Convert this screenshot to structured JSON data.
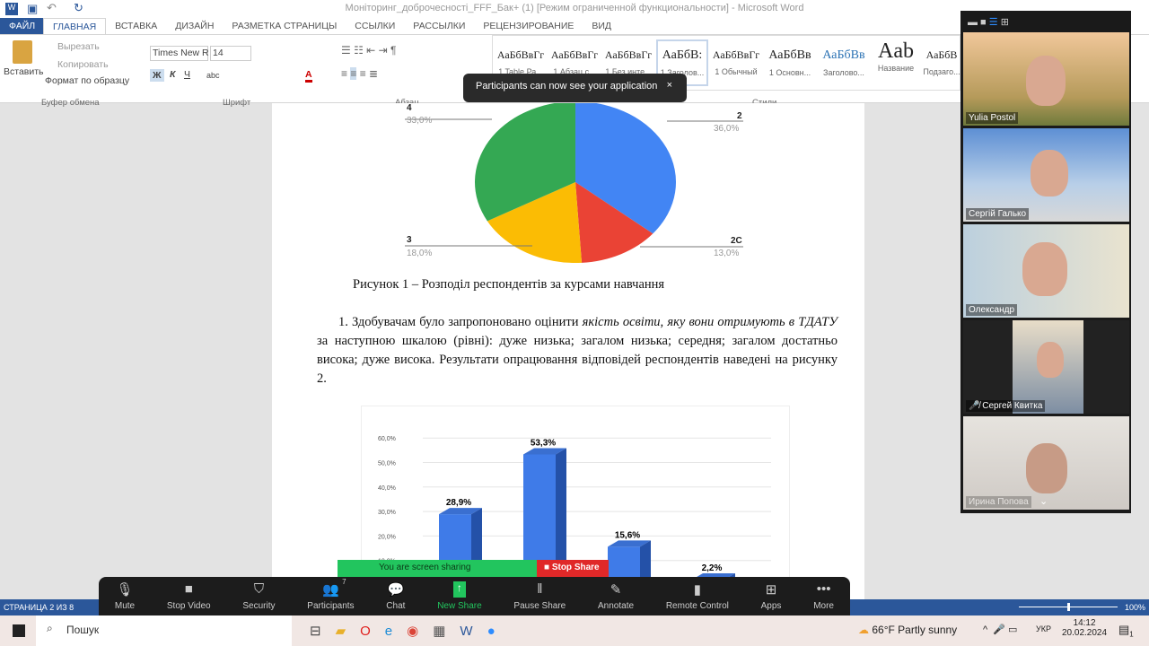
{
  "word": {
    "title": "Моніторинг_доброчесності_FFF_Бак+ (1) [Режим ограниченной функциональности] - Microsoft Word",
    "tabs": [
      "ФАЙЛ",
      "ГЛАВНАЯ",
      "ВСТАВКА",
      "ДИЗАЙН",
      "РАЗМЕТКА СТРАНИЦЫ",
      "ССЫЛКИ",
      "РАССЫЛКИ",
      "РЕЦЕНЗИРОВАНИЕ",
      "ВИД"
    ],
    "clipboard": {
      "paste": "Вставить",
      "cut": "Вырезать",
      "copy": "Копировать",
      "format": "Формат по образцу",
      "group": "Буфер обмена"
    },
    "font": {
      "name": "Times New R",
      "size": "14",
      "bold": "Ж",
      "italic": "К",
      "underline": "Ч",
      "strike": "abc",
      "group": "Шрифт"
    },
    "paragraph_group": "Абзац",
    "styles": [
      {
        "sample": "АаБбВвГг",
        "name": "1 Table Ра..."
      },
      {
        "sample": "АаБбВвГг",
        "name": "1 Абзац с..."
      },
      {
        "sample": "АаБбВвГг",
        "name": "1 Без инте..."
      },
      {
        "sample": "АаБбВ:",
        "name": "1 Заголов..."
      },
      {
        "sample": "АаБбВвГг",
        "name": "1 Обычный"
      },
      {
        "sample": "АаБбВв",
        "name": "1 Основн..."
      },
      {
        "sample": "АаБбВв",
        "name": "Заголово..."
      },
      {
        "sample": "Aab",
        "name": "Название"
      },
      {
        "sample": "АаБбВ",
        "name": "Подзаго..."
      }
    ],
    "styles_group": "Стили",
    "status": {
      "page": "СТРАНИЦА 2 ИЗ 8",
      "zoom": "100%"
    }
  },
  "tooltip": {
    "text": "Participants can now see your application",
    "close": "×"
  },
  "document": {
    "caption": "Рисунок 1 – Розподіл респондентів за курсами навчання",
    "para_a": "1. Здобувачам було запропоновано оцінити ",
    "para_em1": "якість освіти, яку вони отримують в ТДАТУ",
    "para_b": " за наступною шкалою (рівні): дуже низька; загалом низька; середня; загалом достатньо висока; дуже висока. Результати опрацювання відповідей респондентів наведені на рисунку 2."
  },
  "chart_data": [
    {
      "type": "pie",
      "slices": [
        {
          "label": "2",
          "value": 36.0,
          "text": "36,0%",
          "color": "#4285f4"
        },
        {
          "label": "2С",
          "value": 13.0,
          "text": "13,0%",
          "color": "#ea4335"
        },
        {
          "label": "3",
          "value": 18.0,
          "text": "18,0%",
          "color": "#fbbc04"
        },
        {
          "label": "4",
          "value": 33.0,
          "text": "33,0%",
          "color": "#34a853"
        }
      ]
    },
    {
      "type": "bar",
      "values": [
        28.9,
        53.3,
        15.6,
        2.2
      ],
      "labels": [
        "28,9%",
        "53,3%",
        "15,6%",
        "2,2%"
      ],
      "yticks": [
        "10,0%",
        "20,0%",
        "30,0%",
        "40,0%",
        "50,0%",
        "60,0%"
      ],
      "ylim": [
        0,
        60
      ],
      "color": "#3f7be8"
    }
  ],
  "zoom": {
    "sharing": "You are screen sharing",
    "stop_share": "Stop Share",
    "toolbar": [
      {
        "icon": "microphone-icon",
        "glyph": "🎙",
        "label": "Mute"
      },
      {
        "icon": "video-icon",
        "glyph": "■",
        "label": "Stop Video"
      },
      {
        "icon": "shield-icon",
        "glyph": "⛉",
        "label": "Security"
      },
      {
        "icon": "participants-icon",
        "glyph": "👥",
        "label": "Participants",
        "count": "7"
      },
      {
        "icon": "chat-icon",
        "glyph": "💬",
        "label": "Chat"
      },
      {
        "icon": "share-icon",
        "glyph": "↑",
        "label": "New Share"
      },
      {
        "icon": "pause-icon",
        "glyph": "‖",
        "label": "Pause Share"
      },
      {
        "icon": "pencil-icon",
        "glyph": "✎",
        "label": "Annotate"
      },
      {
        "icon": "mouse-icon",
        "glyph": "▮",
        "label": "Remote Control"
      },
      {
        "icon": "apps-icon",
        "glyph": "⊞",
        "label": "Apps"
      },
      {
        "icon": "more-icon",
        "glyph": "•••",
        "label": "More"
      }
    ],
    "participants": [
      "Yulia Postol",
      "Сергій Галько",
      "Олександр",
      "Сергей Квитка",
      "Ирина Попова"
    ]
  },
  "taskbar": {
    "search": "Пошук",
    "weather": "66°F  Partly sunny",
    "lang": "УКР",
    "time": "14:12",
    "date": "20.02.2024",
    "notifications": "1"
  },
  "colors": {
    "word_blue": "#2b579a",
    "zoom_green": "#22c55e",
    "stop_red": "#e02828"
  }
}
